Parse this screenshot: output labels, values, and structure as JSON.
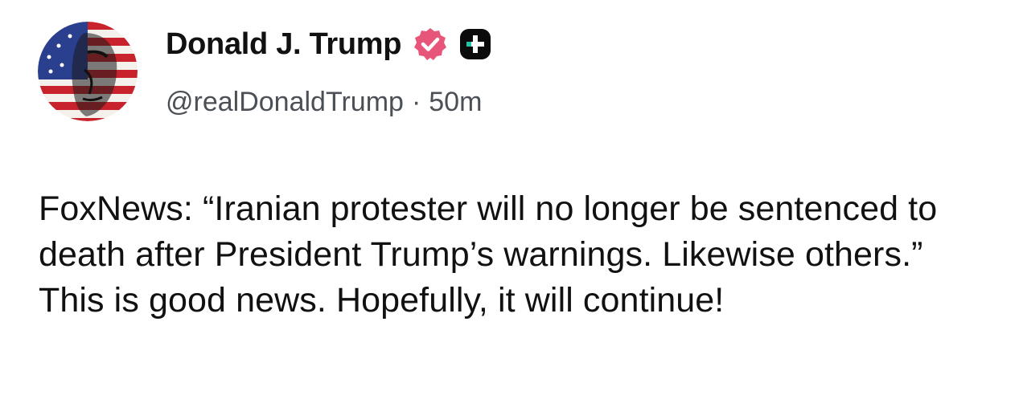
{
  "author": {
    "display_name": "Donald J. Trump",
    "handle": "@realDonaldTrump",
    "separator": "·",
    "timestamp": "50m",
    "verified_icon": "verified-badge-icon",
    "verified_color": "#e8557a",
    "platform_icon": "truth-plus-icon"
  },
  "post": {
    "text": "FoxNews: “Iranian protester will no longer be sentenced to death after President Trump’s warnings. Likewise others.” This is good news. Hopefully, it will continue!"
  }
}
